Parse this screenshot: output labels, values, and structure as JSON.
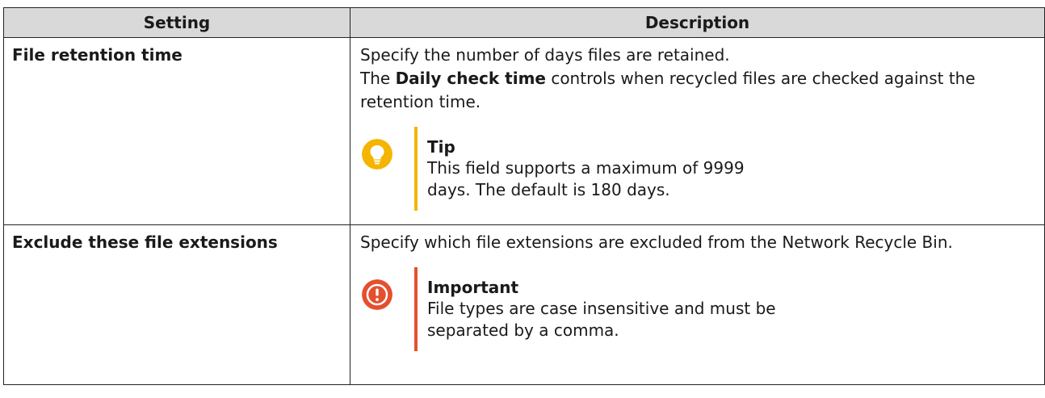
{
  "colors": {
    "header_bg": "#d9d9d9",
    "tip_accent": "#f5b400",
    "important_accent": "#e4502e"
  },
  "table": {
    "headers": [
      "Setting",
      "Description"
    ],
    "rows": [
      {
        "setting": "File retention time",
        "desc_line1": "Specify the number of days files are retained.",
        "desc_line2_pre": "The ",
        "desc_line2_bold": "Daily check time",
        "desc_line2_post": " controls when recycled files are checked against the retention time.",
        "note": {
          "icon": "lightbulb-icon",
          "title": "Tip",
          "text": "This field supports a maximum of 9999 days. The default is 180 days."
        }
      },
      {
        "setting": "Exclude these file extensions",
        "desc_line1": "Specify which file extensions are excluded from the Network Recycle Bin.",
        "note": {
          "icon": "exclamation-icon",
          "title": "Important",
          "text": "File types are case insensitive and must be separated by a comma."
        }
      }
    ]
  }
}
